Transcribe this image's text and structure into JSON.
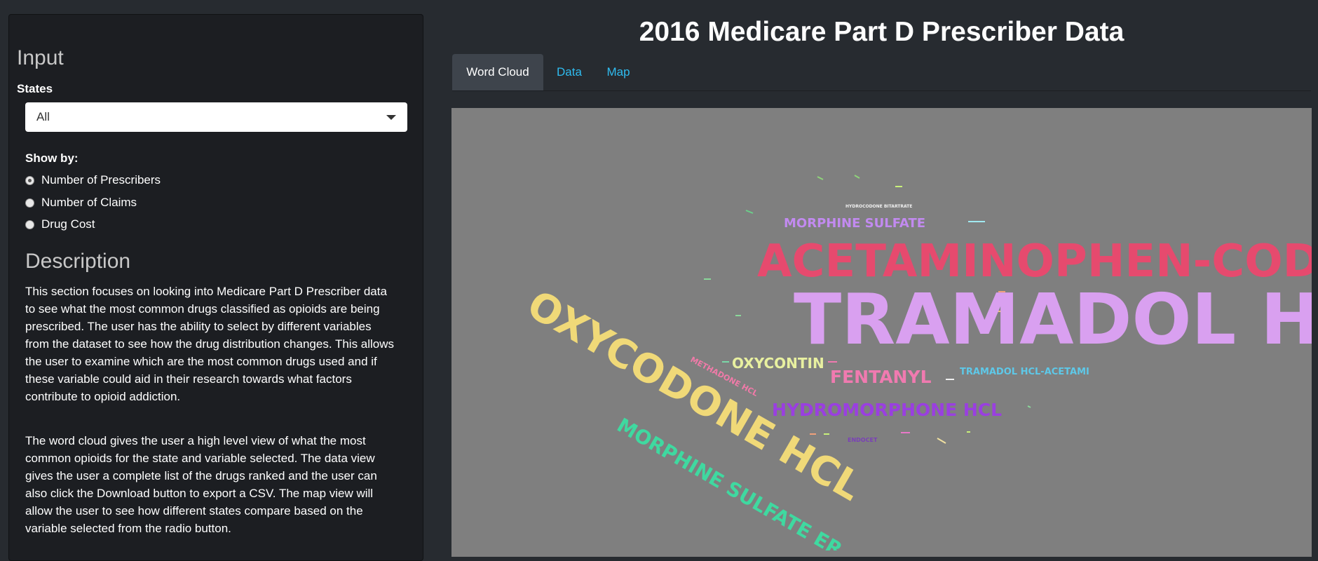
{
  "header": {
    "title": "2016 Medicare Part D Prescriber Data"
  },
  "tabs": [
    {
      "label": "Word Cloud",
      "active": true
    },
    {
      "label": "Data",
      "active": false
    },
    {
      "label": "Map",
      "active": false
    }
  ],
  "sidebar": {
    "input_heading": "Input",
    "states_label": "States",
    "states_selected": "All",
    "show_by_label": "Show by:",
    "radio_options": [
      "Number of Prescribers",
      "Number of Claims",
      "Drug Cost"
    ],
    "radio_selected": 0,
    "description_heading": "Description",
    "paragraph1_lines": [
      "This section focuses on looking into Medicare Part D Prescriber data",
      "to see what the most common drugs classified as opioids are being",
      "prescribed. The user has the ability to select by different variables",
      "from the dataset to see how the drug distribution changes. This allows",
      "the user to examine which are the most common drugs used and if",
      "these variable could aid in their research towards what factors",
      "contribute to opioid addiction."
    ],
    "paragraph2_lines": [
      "The word cloud gives the user a high level view of what the most",
      "common opioids for the state and variable selected. The data view",
      "gives the user a complete list of the drugs ranked and the user can",
      "also click the Download button to export a CSV. The map view will",
      "allow the user to see how different states compare based on the",
      "variable selected from the radio button."
    ]
  },
  "word_cloud": {
    "background": "#7f7f7f",
    "words": [
      {
        "text": "TRAMADOL HCL",
        "color": "#d9a0f0"
      },
      {
        "text": "ACETAMINOPHEN-CODEIN",
        "color": "#e64a6e"
      },
      {
        "text": "OXYCODONE HCL",
        "color": "#f0d978"
      },
      {
        "text": "MORPHINE SULFATE ER",
        "color": "#3fd9a0"
      },
      {
        "text": "HYDROMORPHONE HCL",
        "color": "#9a3fe0"
      },
      {
        "text": "FENTANYL",
        "color": "#f07ab0"
      },
      {
        "text": "OXYCONTIN",
        "color": "#e8f0a0"
      },
      {
        "text": "MORPHINE SULFATE",
        "color": "#c28af0"
      },
      {
        "text": "TRAMADOL HCL-ACETAMI",
        "color": "#5ec8e8"
      },
      {
        "text": "METHADONE HCL",
        "color": "#f07aa8"
      },
      {
        "text": "HYDROCODONE BITARTRATE",
        "color": "#f0f0f0"
      },
      {
        "text": "ENDOCET",
        "color": "#7a3fb8"
      }
    ]
  }
}
